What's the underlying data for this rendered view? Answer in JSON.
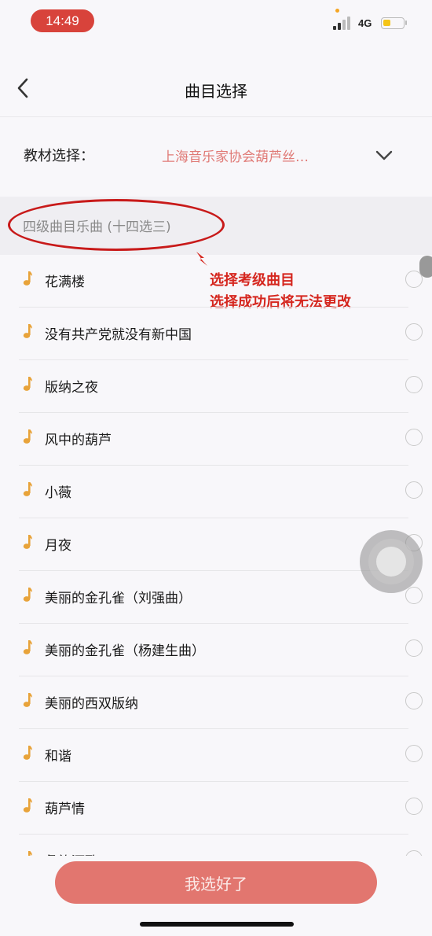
{
  "status_bar": {
    "time": "14:49",
    "network": "4G",
    "battery_level": 0.4,
    "colors": {
      "time_pill": "#d8433b",
      "battery": "#f5c518"
    }
  },
  "navbar": {
    "title": "曲目选择",
    "back_icon": "chevron-left-icon"
  },
  "textbook": {
    "label": "教材选择：",
    "value": "上海音乐家协会葫芦丝…",
    "dropdown_icon": "chevron-down-icon"
  },
  "section": {
    "title": "四级曲目乐曲 (十四选三)"
  },
  "annotation": {
    "line1": "选择考级曲目",
    "line2": "选择成功后将无法更改"
  },
  "songs": [
    {
      "title": "花满楼"
    },
    {
      "title": "没有共产党就没有新中国"
    },
    {
      "title": "版纳之夜"
    },
    {
      "title": "风中的葫芦"
    },
    {
      "title": "小薇"
    },
    {
      "title": "月夜"
    },
    {
      "title": "美丽的金孔雀（刘强曲）"
    },
    {
      "title": "美丽的金孔雀（杨建生曲）"
    },
    {
      "title": "美丽的西双版纳"
    },
    {
      "title": "和谐"
    },
    {
      "title": "葫芦情"
    },
    {
      "title": "彝族酒歌"
    }
  ],
  "confirm_button": {
    "label": "我选好了",
    "color": "#e2766f"
  },
  "accent_color": "#e8a33a"
}
